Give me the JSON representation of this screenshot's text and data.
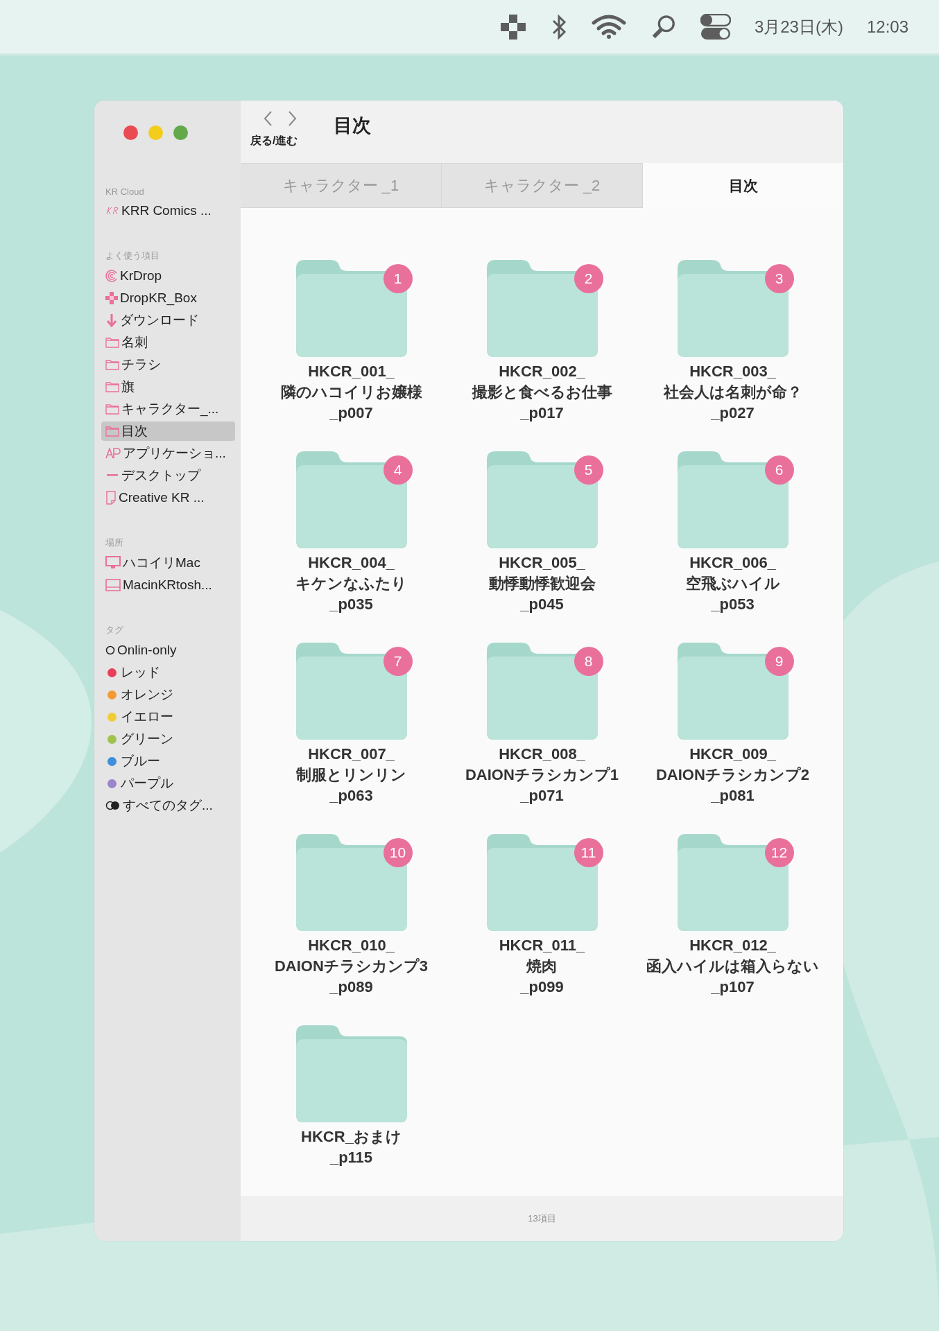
{
  "menu_bar": {
    "date": "3月23日(木)",
    "time": "12:03"
  },
  "window": {
    "title": "目次",
    "nav_label": "戻る/進む",
    "status": "13項目"
  },
  "sidebar": {
    "sections": [
      {
        "heading": "KR Cloud",
        "items": [
          {
            "label": "KRR Comics ...",
            "kind": "kr",
            "selected": false
          }
        ]
      },
      {
        "heading": "よく使う項目",
        "items": [
          {
            "label": "KrDrop",
            "kind": "spiral",
            "selected": false
          },
          {
            "label": "DropKR_Box",
            "kind": "puzzle",
            "selected": false
          },
          {
            "label": "ダウンロード",
            "kind": "download",
            "selected": false
          },
          {
            "label": "名刺",
            "kind": "folder",
            "selected": false
          },
          {
            "label": "チラシ",
            "kind": "folder",
            "selected": false
          },
          {
            "label": "旗",
            "kind": "folder",
            "selected": false
          },
          {
            "label": "キャラクター_...",
            "kind": "folder",
            "selected": false
          },
          {
            "label": "目次",
            "kind": "folder",
            "selected": true
          },
          {
            "label": "アプリケーショ...",
            "kind": "app",
            "selected": false
          },
          {
            "label": "デスクトップ",
            "kind": "dash",
            "selected": false
          },
          {
            "label": "Creative KR ...",
            "kind": "document",
            "selected": false
          }
        ]
      },
      {
        "heading": "場所",
        "items": [
          {
            "label": "ハコイリMac",
            "kind": "desktop",
            "selected": false
          },
          {
            "label": "MacinKRtosh...",
            "kind": "laptop",
            "selected": false
          }
        ]
      },
      {
        "heading": "タグ",
        "items": [
          {
            "label": "Onlin-only",
            "kind": "ring",
            "selected": false
          },
          {
            "label": "レッド",
            "kind": "tag",
            "color": "#e8405a",
            "selected": false
          },
          {
            "label": "オレンジ",
            "kind": "tag",
            "color": "#f39a35",
            "selected": false
          },
          {
            "label": "イエロー",
            "kind": "tag",
            "color": "#f1cd35",
            "selected": false
          },
          {
            "label": "グリーン",
            "kind": "tag",
            "color": "#9fc34f",
            "selected": false
          },
          {
            "label": "ブルー",
            "kind": "tag",
            "color": "#3e8fdc",
            "selected": false
          },
          {
            "label": "パープル",
            "kind": "tag",
            "color": "#9a86c9",
            "selected": false
          },
          {
            "label": "すべてのタグ...",
            "kind": "alltags",
            "selected": false
          }
        ]
      }
    ]
  },
  "tabs": [
    {
      "label": "キャラクター _1",
      "selected": false
    },
    {
      "label": "キャラクター _2",
      "selected": false
    },
    {
      "label": "目次",
      "selected": true
    }
  ],
  "folders": [
    {
      "name": "HKCR_001_\n隣のハコイリお嬢様\n_p007",
      "badge": "1"
    },
    {
      "name": "HKCR_002_\n撮影と食べるお仕事\n_p017",
      "badge": "2"
    },
    {
      "name": "HKCR_003_\n社会人は名刺が命？\n_p027",
      "badge": "3"
    },
    {
      "name": "HKCR_004_\nキケンなふたり\n_p035",
      "badge": "4"
    },
    {
      "name": "HKCR_005_\n動悸動悸歓迎会\n_p045",
      "badge": "5"
    },
    {
      "name": "HKCR_006_\n空飛ぶハイル\n_p053",
      "badge": "6"
    },
    {
      "name": "HKCR_007_\n制服とリンリン\n_p063",
      "badge": "7"
    },
    {
      "name": "HKCR_008_\nDAIONチラシカンプ1\n_p071",
      "badge": "8"
    },
    {
      "name": "HKCR_009_\nDAIONチラシカンプ2\n_p081",
      "badge": "9"
    },
    {
      "name": "HKCR_010_\nDAIONチラシカンプ3\n_p089",
      "badge": "10"
    },
    {
      "name": "HKCR_011_\n焼肉\n_p099",
      "badge": "11"
    },
    {
      "name": "HKCR_012_\n函入ハイルは箱入らない\n_p107",
      "badge": "12"
    },
    {
      "name": "HKCR_おまけ\n_p115"
    }
  ]
}
